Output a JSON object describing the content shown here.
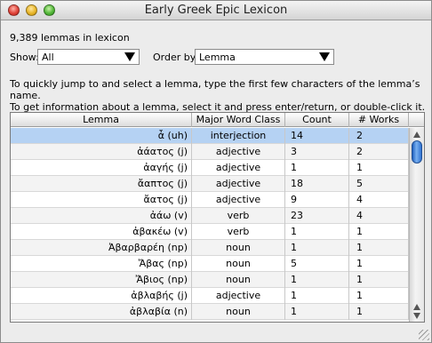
{
  "window": {
    "title": "Early Greek Epic Lexicon"
  },
  "summary": {
    "count_text": "9,389 lemmas in lexicon"
  },
  "filters": {
    "show_label": "Show:",
    "show_value": "All",
    "order_label": "Order by:",
    "order_value": "Lemma"
  },
  "instructions": {
    "line1": "To quickly jump to and select a lemma, type the first few characters of the lemma’s name.",
    "line2": "To get information about a lemma, select it and press enter/return, or double-click it."
  },
  "table": {
    "columns": [
      "Lemma",
      "Major Word Class",
      "Count",
      "# Works"
    ],
    "rows": [
      {
        "lemma": "ἆ (uh)",
        "class": "interjection",
        "count": "14",
        "works": "2",
        "selected": true
      },
      {
        "lemma": "ἀάατος (j)",
        "class": "adjective",
        "count": "3",
        "works": "2"
      },
      {
        "lemma": "ἀαγής (j)",
        "class": "adjective",
        "count": "1",
        "works": "1"
      },
      {
        "lemma": "ἄαπτος (j)",
        "class": "adjective",
        "count": "18",
        "works": "5"
      },
      {
        "lemma": "ἄατος (j)",
        "class": "adjective",
        "count": "9",
        "works": "4"
      },
      {
        "lemma": "ἀάω (v)",
        "class": "verb",
        "count": "23",
        "works": "4"
      },
      {
        "lemma": "ἀβακέω (v)",
        "class": "verb",
        "count": "1",
        "works": "1"
      },
      {
        "lemma": "Ἀβαρβαρέη (np)",
        "class": "noun",
        "count": "1",
        "works": "1"
      },
      {
        "lemma": "Ἄβας (np)",
        "class": "noun",
        "count": "5",
        "works": "1"
      },
      {
        "lemma": "Ἄβιος (np)",
        "class": "noun",
        "count": "1",
        "works": "1"
      },
      {
        "lemma": "ἀβλαβής (j)",
        "class": "adjective",
        "count": "1",
        "works": "1"
      },
      {
        "lemma": "ἀβλαβία (n)",
        "class": "noun",
        "count": "1",
        "works": "1"
      }
    ]
  }
}
